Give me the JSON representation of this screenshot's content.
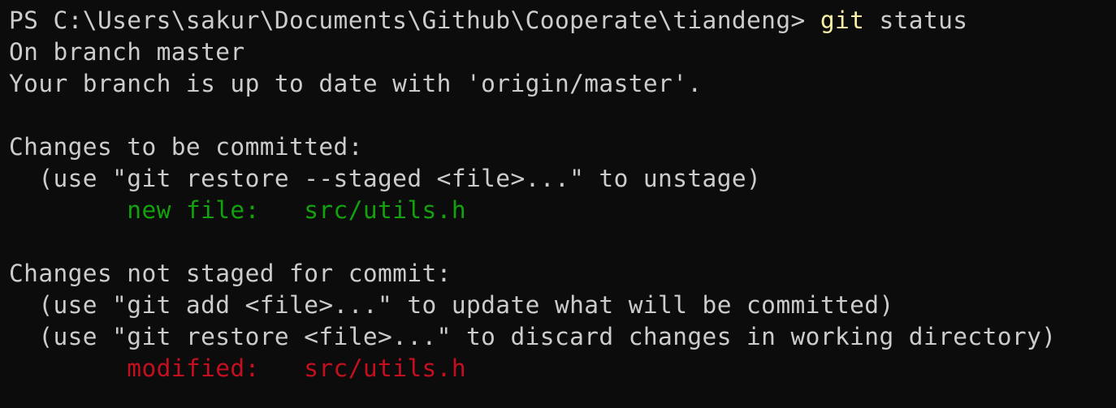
{
  "colors": {
    "background": "#0c0c0c",
    "foreground": "#cccccc",
    "command": "#f9f1a5",
    "staged": "#13a10e",
    "unstaged": "#c50f1f"
  },
  "prompt": {
    "text": "PS C:\\Users\\sakur\\Documents\\Github\\Cooperate\\tiandeng> ",
    "command": "git",
    "args": " status"
  },
  "output": {
    "branch_line": "On branch master",
    "up_to_date_line": "Your branch is up to date with 'origin/master'.",
    "staged": {
      "header": "Changes to be committed:",
      "hint": "  (use \"git restore --staged <file>...\" to unstage)",
      "indent": "        ",
      "entry_status": "new file:   ",
      "entry_path": "src/utils.h"
    },
    "unstaged": {
      "header": "Changes not staged for commit:",
      "hint_add": "  (use \"git add <file>...\" to update what will be committed)",
      "hint_restore": "  (use \"git restore <file>...\" to discard changes in working directory)",
      "indent": "        ",
      "entry_status": "modified:   ",
      "entry_path": "src/utils.h"
    }
  }
}
